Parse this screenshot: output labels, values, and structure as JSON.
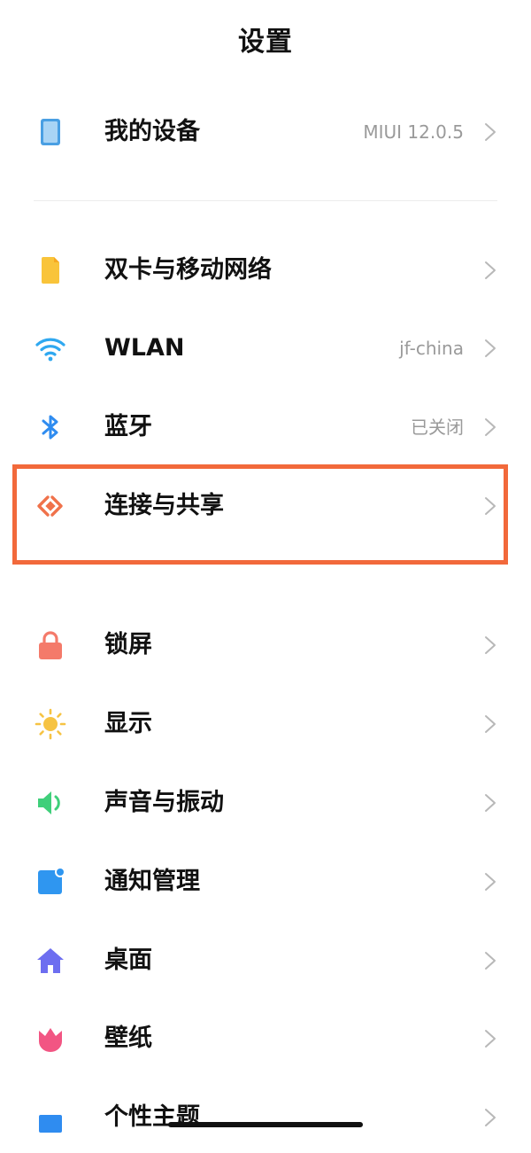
{
  "header": {
    "title": "设置"
  },
  "device": {
    "label": "我的设备",
    "value": "MIUI 12.0.5",
    "icon": "tablet-icon",
    "color": "#4a9fe3"
  },
  "network": [
    {
      "id": "sim",
      "label": "双卡与移动网络",
      "value": "",
      "icon": "sim-card-icon",
      "color": "#f9c43a"
    },
    {
      "id": "wlan",
      "label": "WLAN",
      "value": "jf-china",
      "icon": "wifi-icon",
      "color": "#2fa8f0"
    },
    {
      "id": "bluetooth",
      "label": "蓝牙",
      "value": "已关闭",
      "icon": "bluetooth-icon",
      "color": "#2f8cf0"
    },
    {
      "id": "connection",
      "label": "连接与共享",
      "value": "",
      "icon": "share-icon",
      "color": "#f0724b"
    }
  ],
  "personal": [
    {
      "id": "lockscreen",
      "label": "锁屏",
      "icon": "lock-icon",
      "color": "#f47a6a"
    },
    {
      "id": "display",
      "label": "显示",
      "icon": "sun-icon",
      "color": "#f6c343"
    },
    {
      "id": "sound",
      "label": "声音与振动",
      "icon": "speaker-icon",
      "color": "#3fcf7a"
    },
    {
      "id": "notifications",
      "label": "通知管理",
      "icon": "notification-icon",
      "color": "#2f96f0"
    },
    {
      "id": "desktop",
      "label": "桌面",
      "icon": "home-icon",
      "color": "#6d6ef0"
    },
    {
      "id": "wallpaper",
      "label": "壁纸",
      "icon": "tulip-icon",
      "color": "#f25583"
    },
    {
      "id": "themes",
      "label": "个性主题",
      "icon": "theme-icon",
      "color": "#2f8cf0"
    }
  ],
  "colors": {
    "highlight": "#f2693b",
    "chevron": "#b8b8b8",
    "value_text": "#9a9a9a"
  }
}
